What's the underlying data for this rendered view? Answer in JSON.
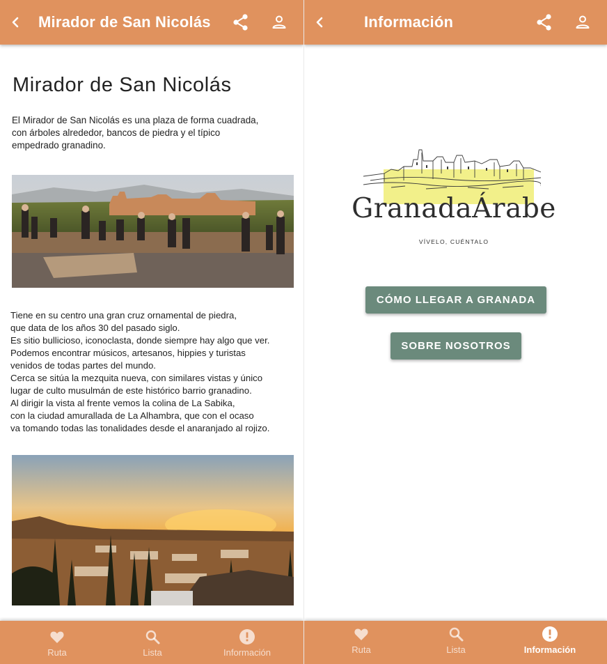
{
  "left_screen": {
    "appbar": {
      "title": "Mirador de San Nicolás",
      "back_icon": "chevron-left-icon",
      "share_icon": "share-icon",
      "user_icon": "person-icon"
    },
    "heading": "Mirador de San Nicolás",
    "intro": "El Mirador de San Nicolás es una plaza de forma cuadrada,\ncon árboles alrededor, bancos de piedra y el típico\nempedrado granadino.",
    "body": "Tiene en su centro una gran cruz ornamental de piedra,\nque data de los años 30 del pasado siglo.\nEs sitio bullicioso, iconoclasta, donde siempre hay algo que ver.\nPodemos encontrar músicos, artesanos, hippies y turistas\nvenidos de todas partes del mundo.\nCerca se sitúa la mezquita nueva, con similares vistas y único\nlugar de culto musulmán de este histórico barrio granadino.\nAl dirigir la vista al frente vemos la colina de La Sabika,\ncon la ciudad amurallada de La Alhambra, que con el ocaso\nva tomando todas las tonalidades desde el anaranjado al rojizo.",
    "tabs": [
      {
        "label": "Ruta",
        "icon": "heart-icon",
        "active": false
      },
      {
        "label": "Lista",
        "icon": "search-icon",
        "active": false
      },
      {
        "label": "Información",
        "icon": "info-icon",
        "active": false
      }
    ]
  },
  "right_screen": {
    "appbar": {
      "title": "Información",
      "back_icon": "chevron-left-icon",
      "share_icon": "share-icon",
      "user_icon": "person-icon"
    },
    "logo": {
      "wordmark": "GranadaÁrabe",
      "tagline": "VÍVELO, CUÉNTALO"
    },
    "buttons": {
      "how_to_get": "CÓMO LLEGAR A GRANADA",
      "about": "SOBRE NOSOTROS"
    },
    "tabs": [
      {
        "label": "Ruta",
        "icon": "heart-icon",
        "active": false
      },
      {
        "label": "Lista",
        "icon": "search-icon",
        "active": false
      },
      {
        "label": "Información",
        "icon": "info-icon",
        "active": true
      }
    ]
  },
  "colors": {
    "appbar": "#e0925e",
    "button": "#6b8a7c",
    "logo_highlight": "#f2f08a"
  }
}
